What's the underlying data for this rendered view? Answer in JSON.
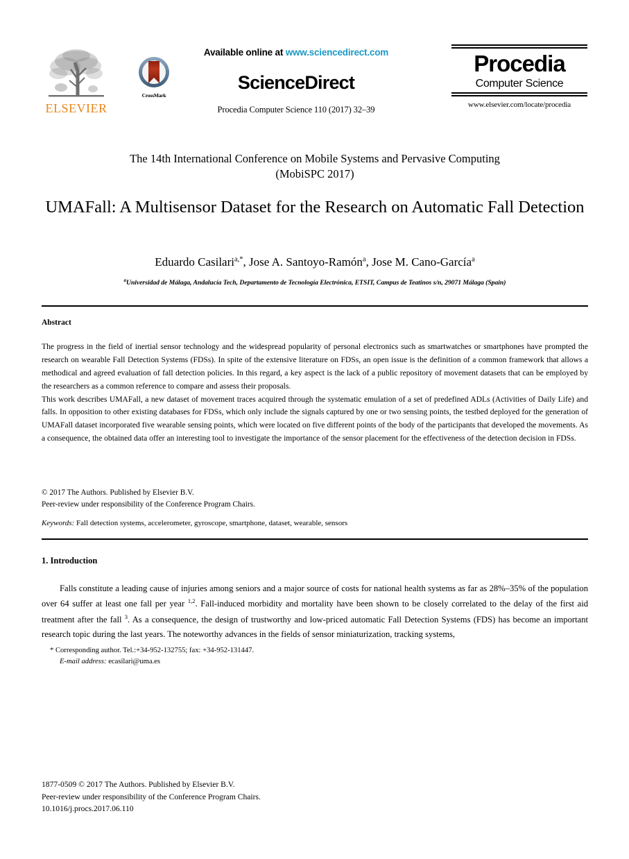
{
  "header": {
    "elsevier": {
      "wordmark": "ELSEVIER",
      "tree_icon": "elsevier-tree-icon"
    },
    "crossmark": {
      "label": "CrossMark",
      "icon": "crossmark-icon"
    },
    "available_prefix": "Available online at ",
    "available_url": "www.sciencedirect.com",
    "sciencedirect_wordmark": "ScienceDirect",
    "journal_reference": "Procedia Computer Science 110 (2017) 32–39",
    "procedia": {
      "title": "Procedia",
      "subtitle": "Computer Science",
      "url": "www.elsevier.com/locate/procedia"
    }
  },
  "conference": {
    "line1": "The 14th International Conference on Mobile Systems and Pervasive Computing",
    "line2": "(MobiSPC 2017)"
  },
  "paper": {
    "title": "UMAFall: A Multisensor Dataset for the Research on Automatic Fall Detection",
    "authors_html": "Eduardo Casilari<sup>a,*</sup>, Jose A. Santoyo-Ramón<sup>a</sup>, Jose M. Cano-García<sup>a</sup>",
    "affiliation_marker": "a",
    "affiliation": "Universidad de Málaga, Andalucía Tech, Departamento de Tecnología Electrónica, ETSIT, Campus de Teatinos s/n, 29071 Málaga (Spain)"
  },
  "abstract": {
    "heading": "Abstract",
    "paragraph1": "The progress in the field of inertial sensor technology and the widespread popularity of personal electronics such as smartwatches or smartphones have prompted the research on wearable Fall Detection Systems (FDSs). In spite of the extensive literature on FDSs, an open issue is the definition of a common framework that allows a methodical and agreed evaluation of fall detection policies. In this regard, a key aspect is the lack of a public repository of movement datasets that can be employed by the researchers as a common reference to compare and assess their proposals.",
    "paragraph2": "This work describes UMAFall, a new dataset of movement traces acquired through the systematic emulation of a set of predefined ADLs (Activities of Daily Life) and falls. In opposition to other existing databases for FDSs, which only include the signals captured by one or two sensing points, the testbed deployed for the generation of UMAFall dataset incorporated five wearable sensing points, which were located on five different points of the body of the participants that developed the movements. As a consequence, the obtained data offer an interesting tool to investigate the importance of the sensor placement for the effectiveness of the detection decision in FDSs."
  },
  "copyright": {
    "line1": "© 2017 The Authors. Published by Elsevier B.V.",
    "line2": "Peer-review under responsibility of the Conference Program Chairs."
  },
  "keywords": {
    "label": "Keywords:",
    "values": "Fall detection systems, accelerometer, gyroscope, smartphone, dataset, wearable, sensors"
  },
  "introduction": {
    "heading": "1. Introduction",
    "body_html": "Falls constitute a leading cause of injuries among seniors and a major source of costs for national health systems as far as 28%–35% of the population over 64 suffer at least one fall per year <sup>1,2</sup>. Fall-induced morbidity and mortality have been shown to be closely correlated to the delay of the first aid treatment after the fall <sup>3</sup>. As a consequence, the design of trustworthy and low-priced automatic Fall Detection Systems (FDS) has become an important research topic during the last years. The noteworthy advances in the fields of sensor miniaturization, tracking systems,"
  },
  "footnote": {
    "corresponding": "* Corresponding author. Tel.:+34-952-132755; fax: +34-952-131447.",
    "email_label": "E-mail address:",
    "email_value": "ecasilari@uma.es"
  },
  "page_footer": {
    "line1": "1877-0509 © 2017 The Authors. Published by Elsevier B.V.",
    "line2": "Peer-review under responsibility of the Conference Program Chairs.",
    "line3": "10.1016/j.procs.2017.06.110"
  },
  "colors": {
    "elsevier_orange": "#E8871A",
    "link_blue": "#1C9AC4",
    "crossmark_red": "#A52A14",
    "crossmark_ring": "#5E7E9B"
  }
}
